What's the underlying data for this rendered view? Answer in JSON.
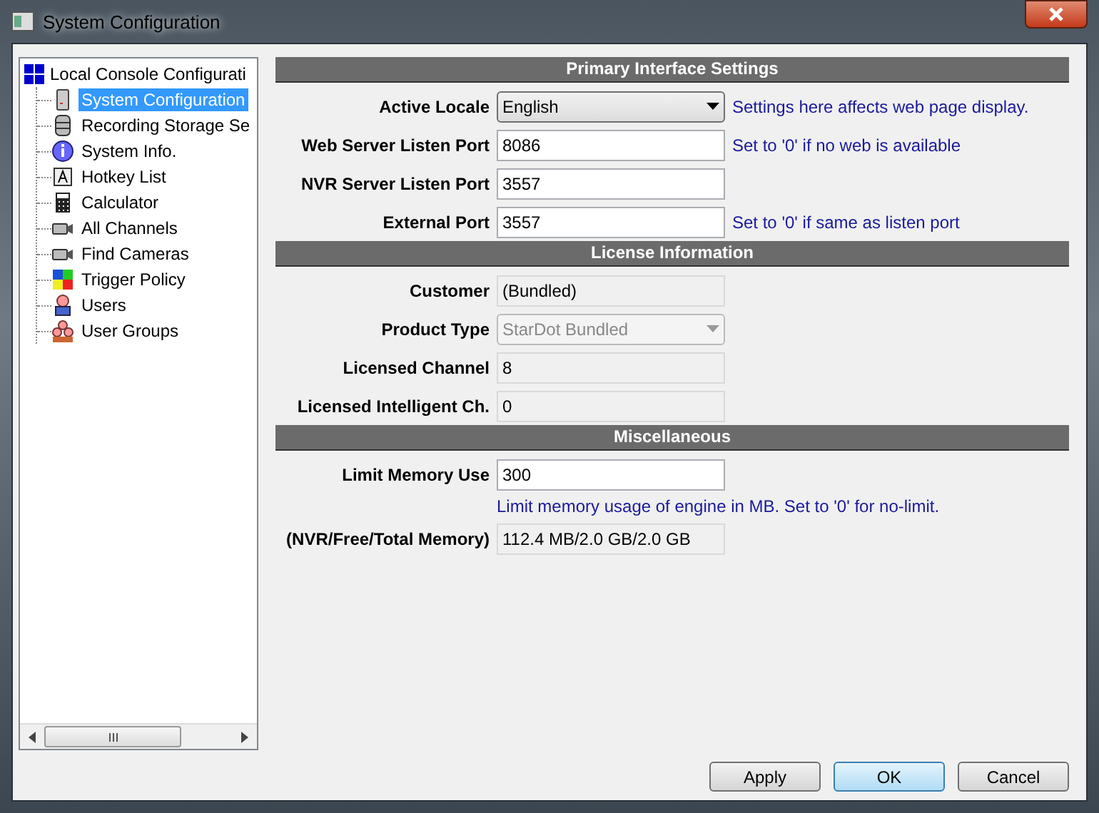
{
  "window": {
    "title": "System Configuration"
  },
  "tree": {
    "label": "Local Console Configurati",
    "children": [
      {
        "label": "System Configuration",
        "selected": true
      },
      {
        "label": "Recording Storage Se",
        "selected": false
      },
      {
        "label": "System Info.",
        "selected": false
      },
      {
        "label": "Hotkey List",
        "selected": false
      },
      {
        "label": "Calculator",
        "selected": false
      },
      {
        "label": "All Channels",
        "selected": false
      },
      {
        "label": "Find Cameras",
        "selected": false
      },
      {
        "label": "Trigger Policy",
        "selected": false
      },
      {
        "label": "Users",
        "selected": false
      },
      {
        "label": "User Groups",
        "selected": false
      }
    ]
  },
  "sections": [
    {
      "title": "Primary Interface Settings",
      "rows": [
        {
          "label": "Active Locale",
          "kind": "select",
          "value": "English",
          "disabled": false,
          "hint": "Settings here affects web page display."
        },
        {
          "label": "Web Server  Listen Port",
          "kind": "input",
          "value": "8086",
          "disabled": false,
          "hint": "Set to '0' if no web is available"
        },
        {
          "label": "NVR Server  Listen Port",
          "kind": "input",
          "value": "3557",
          "disabled": false
        },
        {
          "label": "External Port",
          "kind": "input",
          "value": "3557",
          "disabled": false,
          "hint": "Set to '0' if same as listen port"
        }
      ]
    },
    {
      "title": "License Information",
      "rows": [
        {
          "label": "Customer",
          "kind": "input",
          "value": "(Bundled)",
          "disabled": true
        },
        {
          "label": "Product Type",
          "kind": "select",
          "value": "StarDot Bundled",
          "disabled": true
        },
        {
          "label": "Licensed Channel",
          "kind": "input",
          "value": "8",
          "disabled": true
        },
        {
          "label": "Licensed Intelligent Ch.",
          "kind": "input",
          "value": "0",
          "disabled": true
        }
      ]
    },
    {
      "title": "Miscellaneous",
      "rows": [
        {
          "label": "Limit Memory Use",
          "kind": "input",
          "value": "300",
          "disabled": false,
          "note": "Limit memory usage of engine in MB. Set to '0' for no-limit."
        },
        {
          "label": "(NVR/Free/Total Memory)",
          "kind": "input",
          "value": "112.4 MB/2.0 GB/2.0 GB",
          "disabled": true
        }
      ]
    }
  ],
  "buttons": [
    {
      "label": "Apply",
      "default": false
    },
    {
      "label": "OK",
      "default": true
    },
    {
      "label": "Cancel",
      "default": false
    }
  ]
}
